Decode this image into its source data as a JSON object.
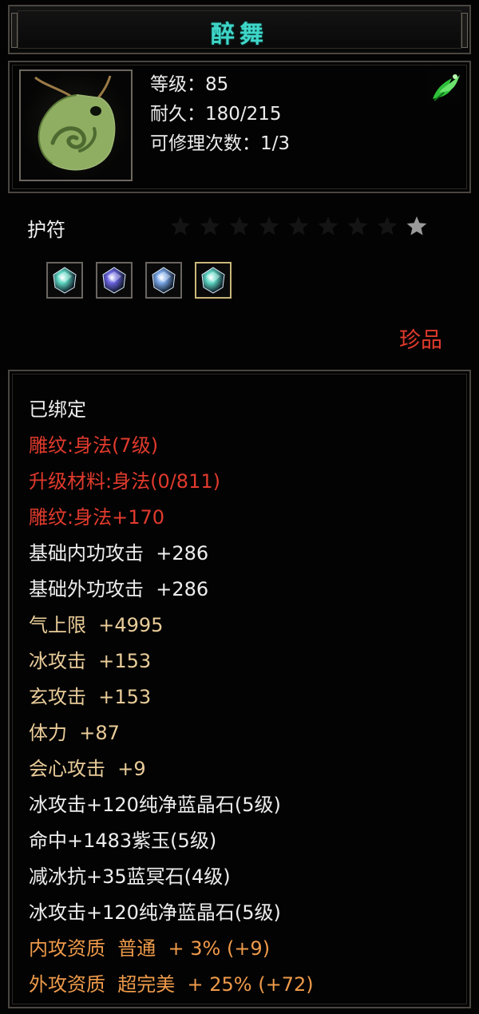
{
  "item": {
    "name": "醉舞",
    "level_line": "等级：85",
    "durability_line": "耐久：180/215",
    "repair_line": "可修理次数：1/3",
    "category": "护符",
    "rarity": "珍品",
    "icon": "jade-amulet-icon",
    "quality_icon": "green-phoenix-icon",
    "stars": {
      "total": 9,
      "filled": 1
    }
  },
  "gem_slots": [
    {
      "icon": "cyan-crystal-icon",
      "color": "#5fd8c4",
      "selected": false
    },
    {
      "icon": "purple-crystal-icon",
      "color": "#6a64e0",
      "selected": false
    },
    {
      "icon": "blue-crystal-icon",
      "color": "#7aa8e8",
      "selected": false
    },
    {
      "icon": "cyan-crystal-icon",
      "color": "#5fd8c4",
      "selected": true
    }
  ],
  "attributes": [
    {
      "text": "已绑定",
      "color": "white"
    },
    {
      "text": "雕纹:身法(7级)",
      "color": "red"
    },
    {
      "text": "升级材料:身法(0/811)",
      "color": "red"
    },
    {
      "text": "雕纹:身法+170",
      "color": "red"
    },
    {
      "text": "基础内功攻击  +286",
      "color": "white"
    },
    {
      "text": "基础外功攻击  +286",
      "color": "white"
    },
    {
      "text": "气上限  +4995",
      "color": "gold"
    },
    {
      "text": "冰攻击  +153",
      "color": "gold"
    },
    {
      "text": "玄攻击  +153",
      "color": "gold"
    },
    {
      "text": "体力  +87",
      "color": "gold"
    },
    {
      "text": "会心攻击  +9",
      "color": "gold"
    },
    {
      "text": "冰攻击+120纯净蓝晶石(5级)",
      "color": "white"
    },
    {
      "text": "命中+1483紫玉(5级)",
      "color": "white"
    },
    {
      "text": "减冰抗+35蓝冥石(4级)",
      "color": "white"
    },
    {
      "text": "冰攻击+120纯净蓝晶石(5级)",
      "color": "white"
    },
    {
      "text": "内攻资质  普通  + 3% (+9)",
      "color": "orange"
    },
    {
      "text": "外攻资质  超完美  + 25% (+72)",
      "color": "orange"
    }
  ],
  "colors": {
    "title": "#3fd6c8",
    "rarity": "#e23a2c",
    "frame": "#4a4640"
  }
}
